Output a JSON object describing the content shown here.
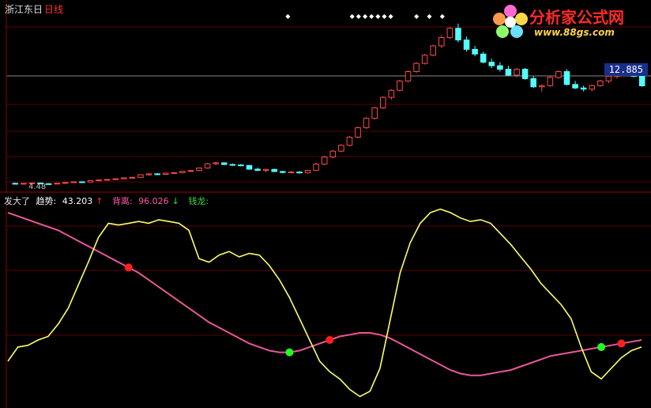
{
  "window": {
    "title": "浙江东日",
    "period": "日线"
  },
  "price_panel": {
    "current_price": "12.885",
    "low_label": "4.48",
    "signal_marker_glyph": "◆"
  },
  "indicator_panel": {
    "name": "发大了",
    "trend": {
      "label": "趋势:",
      "value": "43.203",
      "arrow": "↑"
    },
    "divergence": {
      "label": "背离:",
      "value": "96.026",
      "arrow": "↓"
    },
    "money_dragon": {
      "label": "钱龙:"
    }
  },
  "logo": {
    "site_name": "分析家公式网",
    "url": "www.88gs.com"
  },
  "colors": {
    "background": "#000000",
    "grid": "#5a0000",
    "candle_up": "#ff4a4a",
    "candle_down": "#54ffff",
    "trend_line": "#ffff66",
    "divergence_line": "#e8589a",
    "signal_red": "#ff2020",
    "signal_green": "#20ff20",
    "price_tag_bg": "#1a2f8a"
  },
  "chart_data": [
    {
      "type": "line",
      "title": "日线",
      "kind": "candlestick",
      "series": [
        {
          "name": "",
          "values": [
            [
              4.55,
              4.6,
              4.48,
              4.52
            ],
            [
              4.52,
              4.58,
              4.47,
              4.55
            ],
            [
              4.55,
              4.62,
              4.5,
              4.58
            ],
            [
              4.58,
              4.6,
              4.5,
              4.52
            ],
            [
              4.52,
              4.56,
              4.48,
              4.5
            ],
            [
              4.5,
              4.58,
              4.48,
              4.56
            ],
            [
              4.56,
              4.64,
              4.52,
              4.62
            ],
            [
              4.62,
              4.7,
              4.58,
              4.68
            ],
            [
              4.68,
              4.72,
              4.62,
              4.66
            ],
            [
              4.66,
              4.8,
              4.64,
              4.78
            ],
            [
              4.78,
              4.86,
              4.72,
              4.84
            ],
            [
              4.84,
              4.92,
              4.8,
              4.88
            ],
            [
              4.88,
              4.96,
              4.84,
              4.94
            ],
            [
              4.94,
              5.05,
              4.9,
              5.02
            ],
            [
              5.02,
              5.1,
              4.96,
              5.06
            ],
            [
              5.06,
              5.3,
              5.02,
              5.28
            ],
            [
              5.28,
              5.4,
              5.2,
              5.36
            ],
            [
              5.36,
              5.42,
              5.28,
              5.32
            ],
            [
              5.32,
              5.45,
              5.28,
              5.42
            ],
            [
              5.42,
              5.5,
              5.36,
              5.46
            ],
            [
              5.46,
              5.62,
              5.4,
              5.58
            ],
            [
              5.58,
              5.7,
              5.52,
              5.64
            ],
            [
              5.64,
              5.9,
              5.6,
              5.86
            ],
            [
              5.86,
              6.3,
              5.8,
              6.22
            ],
            [
              6.22,
              6.4,
              6.1,
              6.3
            ],
            [
              6.3,
              6.35,
              6.1,
              6.16
            ],
            [
              6.16,
              6.24,
              6.05,
              6.12
            ],
            [
              6.12,
              6.2,
              6.0,
              6.08
            ],
            [
              6.08,
              6.12,
              5.7,
              5.76
            ],
            [
              5.76,
              5.9,
              5.6,
              5.66
            ],
            [
              5.66,
              5.8,
              5.5,
              5.74
            ],
            [
              5.74,
              5.8,
              5.5,
              5.56
            ],
            [
              5.56,
              5.62,
              5.4,
              5.48
            ],
            [
              5.48,
              5.6,
              5.4,
              5.52
            ],
            [
              5.52,
              5.58,
              5.38,
              5.44
            ],
            [
              5.44,
              5.7,
              5.4,
              5.66
            ],
            [
              5.66,
              6.3,
              5.62,
              6.2
            ],
            [
              6.2,
              6.9,
              6.1,
              6.8
            ],
            [
              6.8,
              7.4,
              6.7,
              7.3
            ],
            [
              7.3,
              7.9,
              7.2,
              7.8
            ],
            [
              7.8,
              8.6,
              7.7,
              8.5
            ],
            [
              8.5,
              9.4,
              8.4,
              9.3
            ],
            [
              9.3,
              10.2,
              9.2,
              10.1
            ],
            [
              10.1,
              11.1,
              10.0,
              11.0
            ],
            [
              11.0,
              12.0,
              10.9,
              11.9
            ],
            [
              11.9,
              12.6,
              11.7,
              12.5
            ],
            [
              12.5,
              13.4,
              12.4,
              13.3
            ],
            [
              13.3,
              14.2,
              13.2,
              14.1
            ],
            [
              14.1,
              14.9,
              14.0,
              14.8
            ],
            [
              14.8,
              15.6,
              14.7,
              15.5
            ],
            [
              15.5,
              16.4,
              15.4,
              16.3
            ],
            [
              16.3,
              17.2,
              16.1,
              17.0
            ],
            [
              17.0,
              17.9,
              16.9,
              17.8
            ],
            [
              17.8,
              18.2,
              16.6,
              16.8
            ],
            [
              16.8,
              17.1,
              15.8,
              16.0
            ],
            [
              16.0,
              16.3,
              15.4,
              15.6
            ],
            [
              15.6,
              15.8,
              14.8,
              14.9
            ],
            [
              14.9,
              15.2,
              14.4,
              14.6
            ],
            [
              14.6,
              14.9,
              14.1,
              14.3
            ],
            [
              14.3,
              14.6,
              13.7,
              13.8
            ],
            [
              13.8,
              14.4,
              13.6,
              14.3
            ],
            [
              14.3,
              14.4,
              13.4,
              13.5
            ],
            [
              13.5,
              13.7,
              12.7,
              12.8
            ],
            [
              12.8,
              13.0,
              12.4,
              12.9
            ],
            [
              12.9,
              13.7,
              12.8,
              13.6
            ],
            [
              13.6,
              14.2,
              13.5,
              14.1
            ],
            [
              14.1,
              14.3,
              12.9,
              13.0
            ],
            [
              13.0,
              13.3,
              12.6,
              12.7
            ],
            [
              12.7,
              12.9,
              12.4,
              12.6
            ],
            [
              12.6,
              13.0,
              12.4,
              12.9
            ],
            [
              12.9,
              13.4,
              12.8,
              13.3
            ],
            [
              13.3,
              13.8,
              13.1,
              13.7
            ],
            [
              13.7,
              14.0,
              13.5,
              13.8
            ],
            [
              13.8,
              14.6,
              13.7,
              14.5
            ],
            [
              14.5,
              14.6,
              13.6,
              13.7
            ],
            [
              13.7,
              13.9,
              12.8,
              12.885
            ]
          ]
        }
      ],
      "price_range": [
        4.0,
        19.0
      ]
    },
    {
      "type": "line",
      "title": "",
      "series": [
        {
          "name": "趋势",
          "values": [
            12,
            20,
            21,
            24,
            26,
            33,
            42,
            55,
            68,
            82,
            90,
            89,
            90,
            91,
            90,
            92,
            91,
            90,
            86,
            70,
            68,
            72,
            74,
            71,
            73,
            72,
            66,
            58,
            48,
            36,
            24,
            12,
            6,
            2,
            -4,
            -8,
            -5,
            8,
            35,
            62,
            79,
            90,
            96,
            98,
            96,
            93,
            91,
            92,
            90,
            84,
            78,
            71,
            64,
            56,
            50,
            44,
            36,
            20,
            6,
            2,
            8,
            14,
            18,
            20
          ]
        },
        {
          "name": "背离",
          "values": [
            96,
            94,
            92,
            90,
            88,
            86,
            83,
            80,
            77,
            74,
            71,
            68,
            65,
            62,
            58,
            54,
            50,
            46,
            42,
            38,
            34,
            31,
            28,
            25,
            22,
            20,
            18,
            17,
            17,
            18,
            20,
            22,
            24,
            26,
            27,
            28,
            28,
            27,
            25,
            22,
            19,
            16,
            13,
            10,
            7,
            5,
            4,
            4,
            5,
            6,
            7,
            9,
            11,
            13,
            15,
            16,
            17,
            18,
            19,
            20,
            21,
            22,
            23,
            24
          ]
        }
      ],
      "signals": [
        {
          "type": "sell",
          "color": "red",
          "x_index": 12
        },
        {
          "type": "buy",
          "color": "green",
          "x_index": 28
        },
        {
          "type": "sell",
          "color": "red",
          "x_index": 32
        },
        {
          "type": "buy",
          "color": "green",
          "x_index": 59
        },
        {
          "type": "sell",
          "color": "red",
          "x_index": 61
        }
      ],
      "ylim": [
        -10,
        100
      ]
    }
  ]
}
